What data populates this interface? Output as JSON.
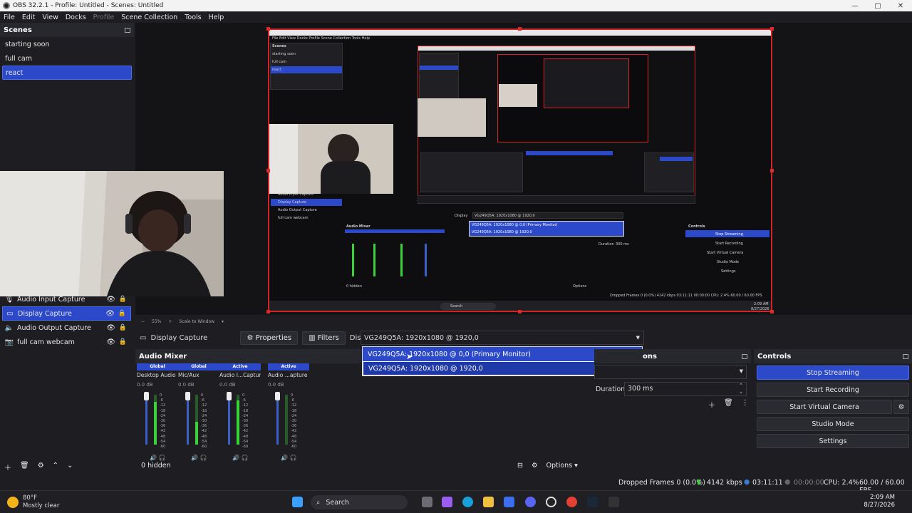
{
  "window": {
    "title": "OBS 32.2.1 - Profile: Untitled - Scenes: Untitled",
    "min": "—",
    "max": "▢",
    "close": "✕"
  },
  "menu": [
    "File",
    "Edit",
    "View",
    "Docks",
    "Profile",
    "Scene Collection",
    "Tools",
    "Help"
  ],
  "scenes": {
    "title": "Scenes",
    "items": [
      "starting soon",
      "full cam",
      "react"
    ],
    "selected_index": 2
  },
  "sources": {
    "items": [
      {
        "label": "Audio Input Capture",
        "icon": "microphone-icon"
      },
      {
        "label": "Display Capture",
        "icon": "monitor-icon",
        "selected": true
      },
      {
        "label": "Audio Output Capture",
        "icon": "speaker-icon"
      },
      {
        "label": "full cam webcam",
        "icon": "camera-icon"
      }
    ]
  },
  "zoom": {
    "minus": "−",
    "value": "55%",
    "plus": "+",
    "mode": "Scale to Window"
  },
  "source_toolbar": {
    "source_name": "Display Capture",
    "properties": "Properties",
    "filters": "Filters",
    "display_label": "Display",
    "display_value": "VG249Q5A: 1920x1080 @ 1920,0"
  },
  "display_dropdown": {
    "options": [
      "VG249Q5A: 1920x1080 @ 0,0 (Primary Monitor)",
      "VG249Q5A: 1920x1080 @ 1920,0"
    ],
    "hovered_index": 0,
    "selected_index": 1
  },
  "mixer": {
    "title": "Audio Mixer",
    "channels": [
      {
        "badge": "Global",
        "name": "Desktop Audio",
        "db": "0.0 dB",
        "level": 0.85
      },
      {
        "badge": "Global",
        "name": "Mic/Aux",
        "db": "0.0 dB",
        "level": 0.45
      },
      {
        "badge": "Active",
        "name": "Audio I...Capture",
        "db": "0.0 dB",
        "level": 0.88
      },
      {
        "badge": "Active",
        "name": "Audio ...apture",
        "db": "0.0 dB",
        "level": 0.0
      }
    ],
    "scale": [
      "0",
      "-6",
      "-12",
      "-18",
      "-24",
      "-30",
      "-36",
      "-42",
      "-48",
      "-54",
      "-60"
    ],
    "hidden_count": "0 hidden",
    "options": "Options"
  },
  "transitions": {
    "title_partial": "ons",
    "duration_label": "Duration",
    "duration_value": "300 ms"
  },
  "controls": {
    "title": "Controls",
    "buttons": [
      "Stop Streaming",
      "Start Recording",
      "Start Virtual Camera",
      "Studio Mode",
      "Settings"
    ]
  },
  "status": {
    "dropped": "Dropped Frames 0 (0.0%)",
    "bitrate": "4142 kbps",
    "stream_time": "03:11:11",
    "rec_time": "00:00:00",
    "cpu": "CPU: 2.4%",
    "fps": "60.00 / 60.00 FPS"
  },
  "taskbar": {
    "temp": "80°F",
    "weather": "Mostly clear",
    "search": "Search",
    "time": "2:09 AM",
    "date": "8/27/2026"
  },
  "nested": {
    "menu": "File  Edit  View  Docks  Profile  Scene Collection  Tools  Help",
    "scenes_title": "Scenes",
    "scenes": [
      "starting soon",
      "full cam",
      "react"
    ],
    "sources": [
      "Audio Input Capture",
      "Display Capture",
      "Audio Output Capture",
      "full cam webcam"
    ],
    "controls_title": "Controls",
    "controls": [
      "Stop Streaming",
      "Start Recording",
      "Start Virtual Camera",
      "Studio Mode",
      "Settings"
    ],
    "mixer_title": "Audio Mixer",
    "dropdown": [
      "VG249Q5A: 1920x1080 @ 0,0 (Primary Monitor)",
      "VG249Q5A: 1920x1080 @ 1920,0"
    ],
    "display_label": "Display",
    "display_value": "VG249Q5A: 1920x1080 @ 1920,0",
    "duration_label": "Duration",
    "duration_value": "300 ms",
    "status": "Dropped Frames 0 (0.0%)   4142 kbps   03:11:11   00:00:00   CPU: 2.4%   60.00 / 60.00 FPS",
    "time": "2:09 AM",
    "date": "8/27/2026",
    "search": "Search",
    "hidden": "0 hidden",
    "options": "Options"
  }
}
